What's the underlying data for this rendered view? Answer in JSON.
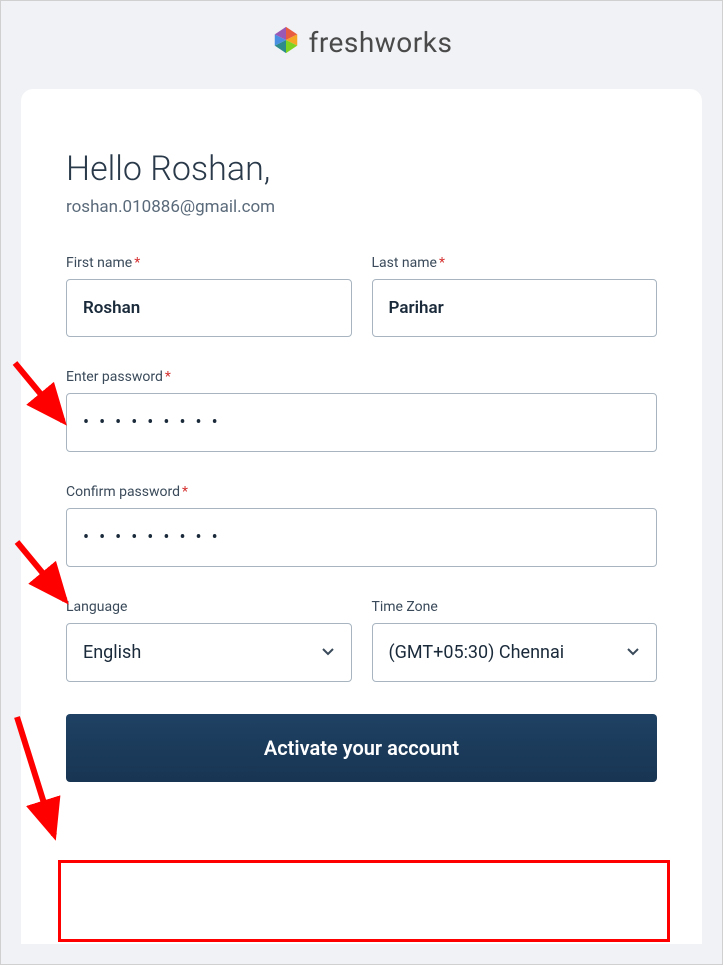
{
  "brand": "freshworks",
  "greeting": "Hello Roshan,",
  "email": "roshan.010886@gmail.com",
  "fields": {
    "first_name": {
      "label": "First name",
      "value": "Roshan",
      "required": true
    },
    "last_name": {
      "label": "Last name",
      "value": "Parihar",
      "required": true
    },
    "password": {
      "label": "Enter password",
      "value": "•••••••••",
      "required": true
    },
    "confirm_password": {
      "label": "Confirm password",
      "value": "•••••••••",
      "required": true
    },
    "language": {
      "label": "Language",
      "value": "English",
      "required": false
    },
    "timezone": {
      "label": "Time Zone",
      "value": "(GMT+05:30) Chennai",
      "required": false
    }
  },
  "activate_button": "Activate your account"
}
